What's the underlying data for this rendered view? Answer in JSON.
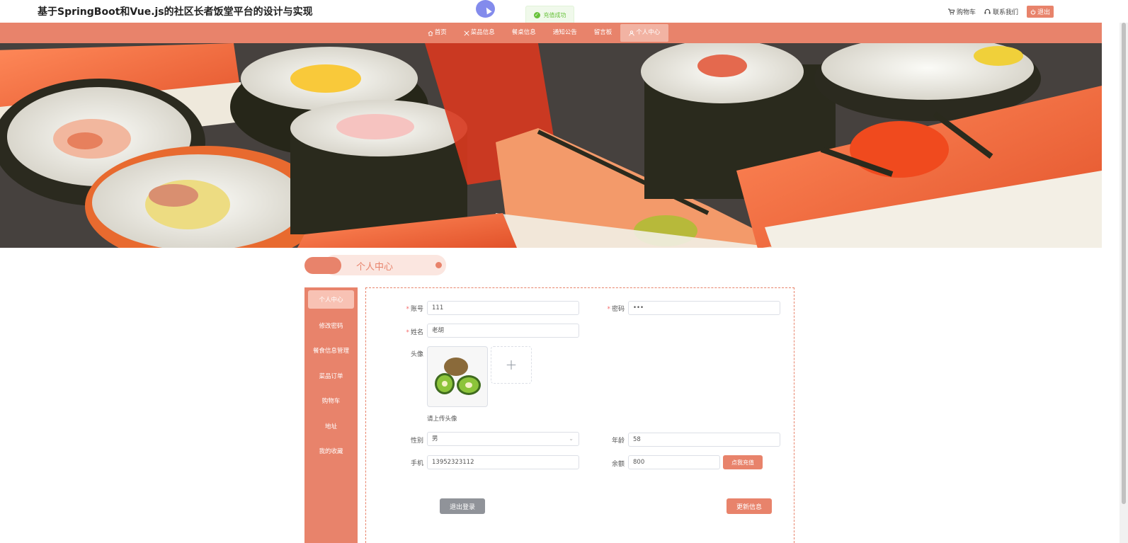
{
  "header": {
    "title": "基于SpringBoot和Vue.js的社区长者饭堂平台的设计与实现",
    "cart_label": "购物车",
    "contact_label": "联系我们",
    "logout_label": "退出"
  },
  "toast": {
    "message": "充值成功"
  },
  "nav": {
    "items": [
      {
        "label": "首页",
        "icon": "home-icon"
      },
      {
        "label": "菜品信息",
        "icon": "utensils-icon"
      },
      {
        "label": "餐桌信息",
        "icon": ""
      },
      {
        "label": "通知公告",
        "icon": ""
      },
      {
        "label": "留言板",
        "icon": ""
      },
      {
        "label": "个人中心",
        "icon": "user-icon"
      }
    ],
    "active_index": 5
  },
  "section": {
    "title": "个人中心"
  },
  "sidebar": {
    "items": [
      {
        "label": "个人中心"
      },
      {
        "label": "修改密码"
      },
      {
        "label": "餐食信息管理"
      },
      {
        "label": "菜品订单"
      },
      {
        "label": "购物车"
      },
      {
        "label": "地址"
      },
      {
        "label": "我的收藏"
      }
    ]
  },
  "form": {
    "account_label": "账号",
    "account_value": "111",
    "password_label": "密码",
    "password_value": "•••",
    "name_label": "姓名",
    "name_value": "老胡",
    "avatar_label": "头像",
    "avatar_hint": "请上传头像",
    "upload_plus": "+",
    "gender_label": "性别",
    "gender_value": "男",
    "age_label": "年龄",
    "age_value": "58",
    "phone_label": "手机",
    "phone_value": "13952323112",
    "balance_label": "余额",
    "balance_value": "800",
    "recharge_label": "点我充值",
    "logout_button": "退出登录",
    "update_button": "更新信息"
  },
  "colors": {
    "primary": "#e8836b",
    "primary_light": "#f8c2b4",
    "success": "#67c23a",
    "gray_button": "#909399"
  }
}
